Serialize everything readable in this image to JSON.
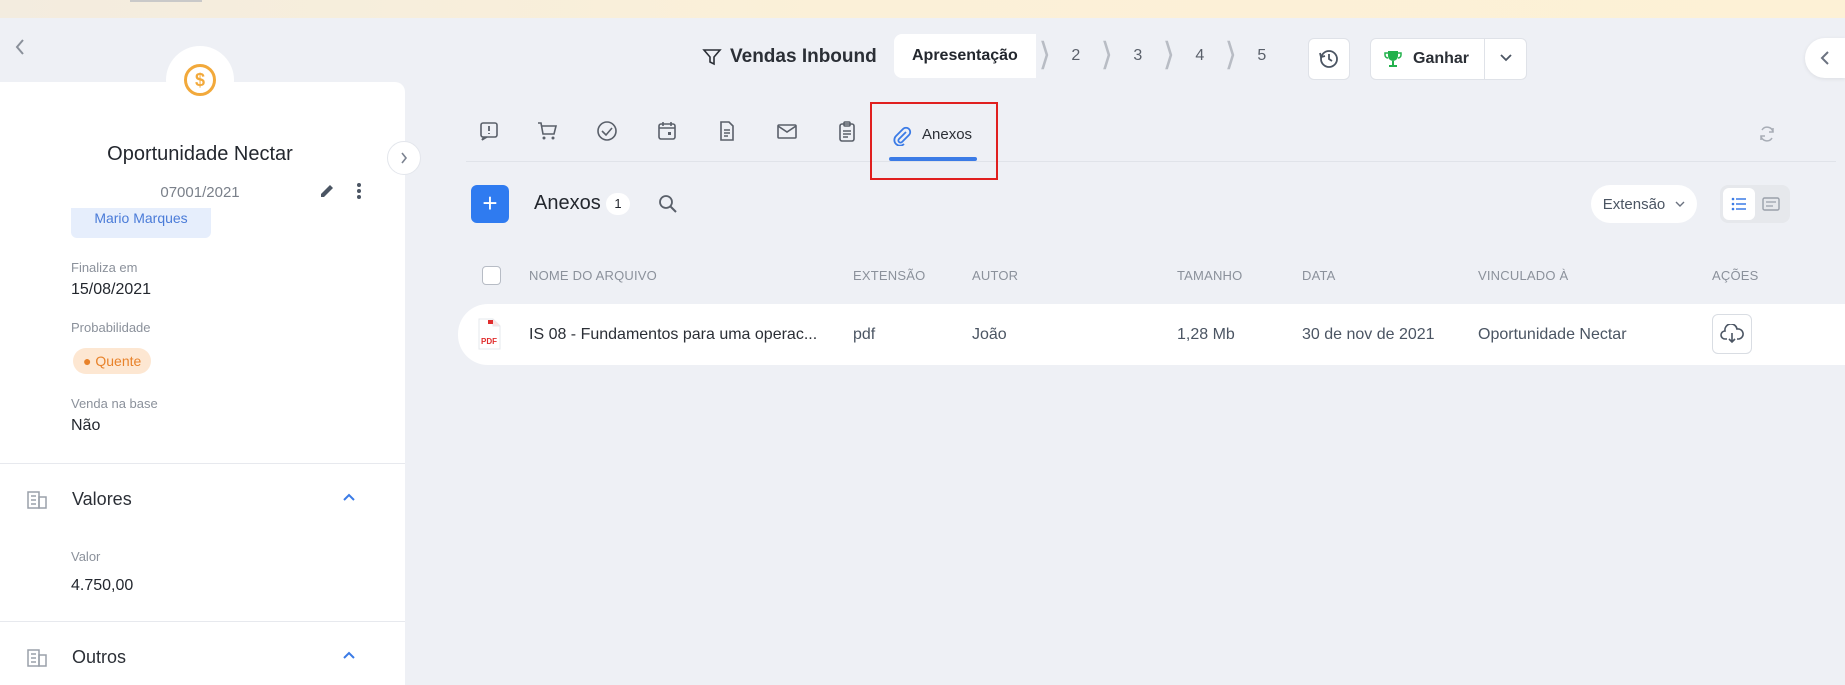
{
  "deal": {
    "title": "Oportunidade Nectar",
    "code": "07001/2021",
    "owner": "Mario Marques"
  },
  "fields": {
    "finaliza_label": "Finaliza em",
    "finaliza_value": "15/08/2021",
    "probabilidade_label": "Probabilidade",
    "probabilidade_value": "Quente",
    "venda_base_label": "Venda na base",
    "venda_base_value": "Não"
  },
  "sections": {
    "valores": {
      "title": "Valores",
      "valor_label": "Valor",
      "valor_value": "4.750,00"
    },
    "outros": {
      "title": "Outros"
    }
  },
  "pipeline": {
    "name": "Vendas Inbound",
    "current_stage": "Apresentação",
    "stages": [
      "2",
      "3",
      "4",
      "5"
    ]
  },
  "actions": {
    "win_label": "Ganhar"
  },
  "tabs": {
    "active_label": "Anexos",
    "icons": [
      "alert-note-icon",
      "cart-icon",
      "check-circle-icon",
      "calendar-icon",
      "document-icon",
      "mail-icon",
      "clipboard-icon",
      "paperclip-icon"
    ]
  },
  "attachments": {
    "title": "Anexos",
    "count": "1",
    "filter_label": "Extensão",
    "columns": {
      "nome": "Nome do arquivo",
      "extensao": "Extensão",
      "autor": "Autor",
      "tamanho": "Tamanho",
      "data": "Data",
      "vinculado": "Vinculado à",
      "acoes": "Ações"
    },
    "rows": [
      {
        "file_badge": "PDF",
        "nome": "IS 08 - Fundamentos para uma operac...",
        "extensao": "pdf",
        "autor": "João",
        "tamanho": "1,28 Mb",
        "data": "30 de nov de 2021",
        "vinculado": "Oportunidade Nectar"
      }
    ]
  },
  "colors": {
    "accent": "#2f7bf0",
    "highlight_box": "#e01f1f",
    "hot": "#e8822a",
    "trophy": "#22b14c",
    "avatar": "#f2a93b"
  }
}
